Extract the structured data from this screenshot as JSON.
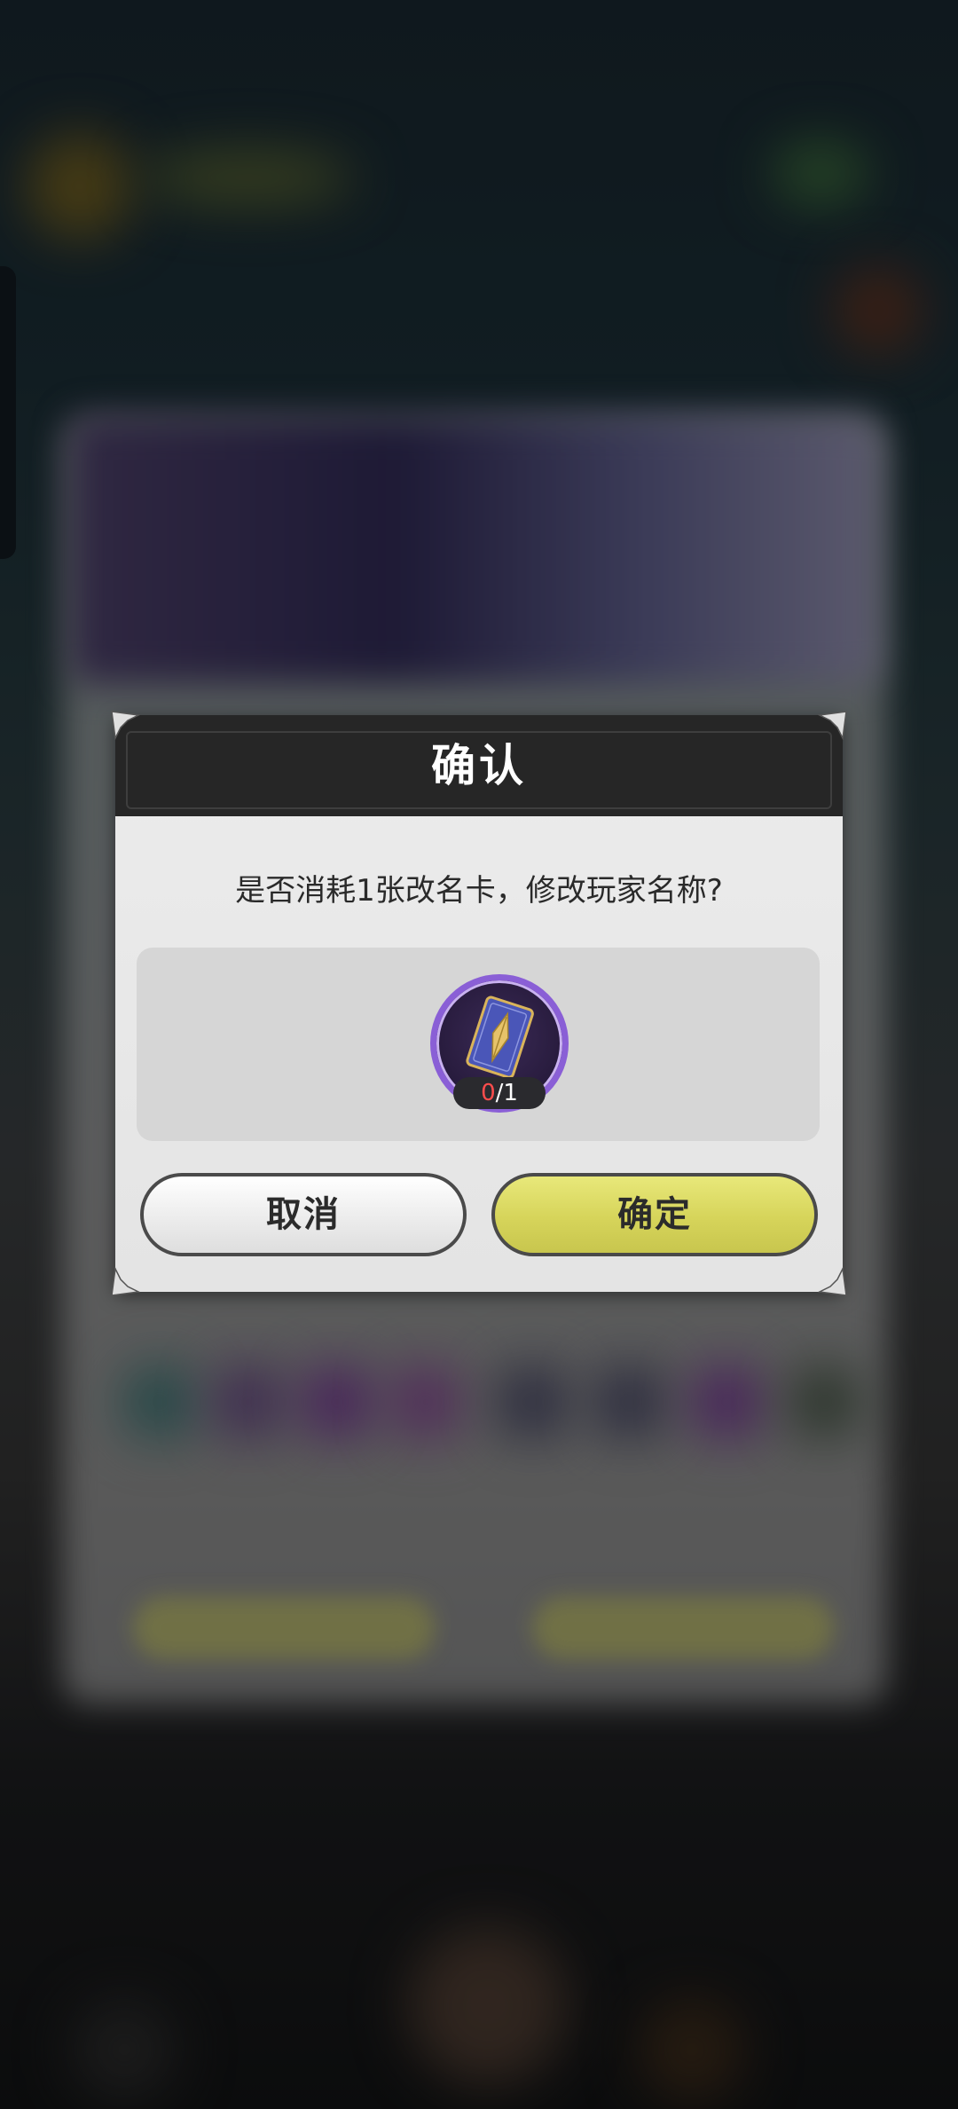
{
  "dialog": {
    "title": "确认",
    "message": "是否消耗1张改名卡，修改玩家名称?",
    "item": {
      "icon": "rename-card-icon",
      "owned": "0",
      "required": "/1"
    },
    "cancel_label": "取消",
    "confirm_label": "确定"
  },
  "colors": {
    "header": "#262626",
    "confirm_button": "#d6d45a",
    "item_border": "#8a5fd6",
    "count_owned": "#ff4d4d"
  }
}
